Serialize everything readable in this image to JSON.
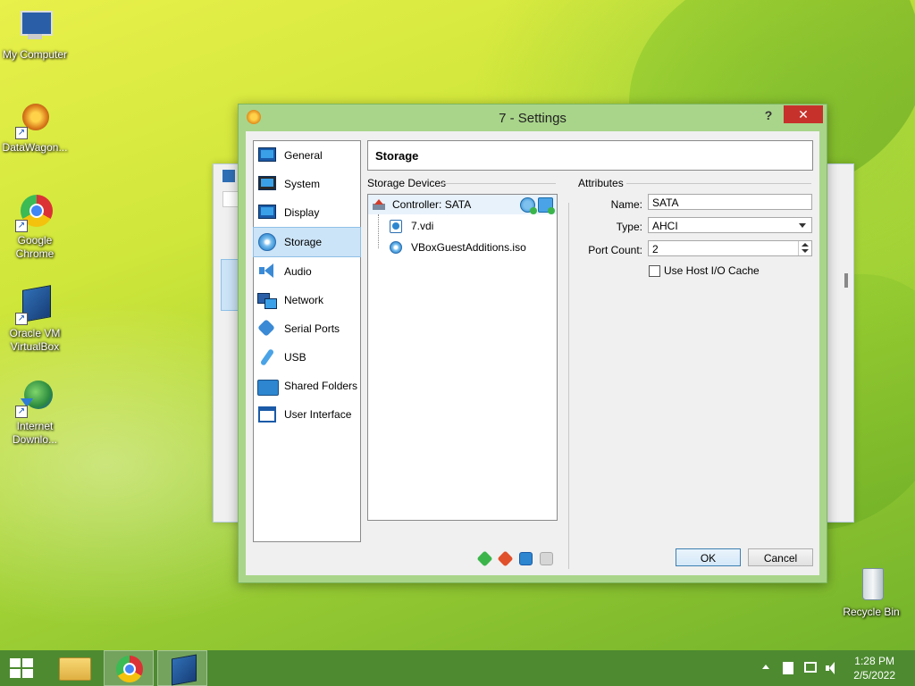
{
  "desktop": {
    "icons": [
      {
        "label": "My Computer"
      },
      {
        "label": "DataWagon..."
      },
      {
        "label": "Google Chrome"
      },
      {
        "label": "Oracle VM VirtualBox"
      },
      {
        "label": "Internet Downlo..."
      }
    ],
    "recycle_bin": "Recycle Bin"
  },
  "dialog": {
    "title": "7 - Settings",
    "help_label": "?",
    "close_label": "✕",
    "nav": [
      {
        "label": "General",
        "icon": "monitor-icon"
      },
      {
        "label": "System",
        "icon": "chip-icon"
      },
      {
        "label": "Display",
        "icon": "display-icon"
      },
      {
        "label": "Storage",
        "icon": "disk-icon",
        "selected": true
      },
      {
        "label": "Audio",
        "icon": "speaker-icon"
      },
      {
        "label": "Network",
        "icon": "network-icon"
      },
      {
        "label": "Serial Ports",
        "icon": "serial-port-icon"
      },
      {
        "label": "USB",
        "icon": "usb-icon"
      },
      {
        "label": "Shared Folders",
        "icon": "folder-icon"
      },
      {
        "label": "User Interface",
        "icon": "window-icon"
      }
    ],
    "page_title": "Storage",
    "storage_devices_label": "Storage Devices",
    "tree": {
      "controller": "Controller: SATA",
      "items": [
        "7.vdi",
        "VBoxGuestAdditions.iso"
      ]
    },
    "attributes": {
      "group_label": "Attributes",
      "name_label": "Name:",
      "name_value": "SATA",
      "type_label": "Type:",
      "type_value": "AHCI",
      "port_count_label": "Port Count:",
      "port_count_value": "2",
      "host_io_cache_label": "Use Host I/O Cache",
      "host_io_cache_checked": false
    },
    "ok_label": "OK",
    "cancel_label": "Cancel"
  },
  "taskbar": {
    "time": "1:28 PM",
    "date": "2/5/2022"
  }
}
